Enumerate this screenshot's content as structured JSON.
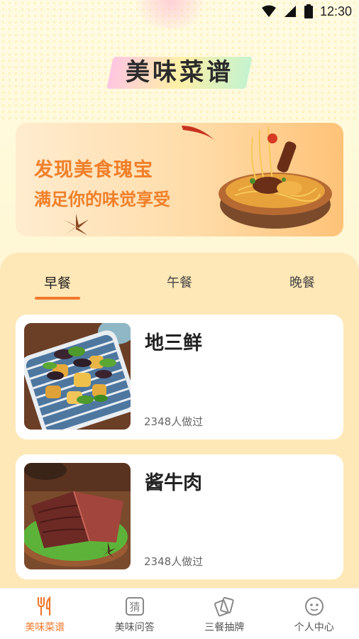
{
  "status_bar": {
    "time": "12:30"
  },
  "app": {
    "title": "美味菜谱"
  },
  "banner": {
    "line1": "发现美食瑰宝",
    "line2": "满足你的味觉享受"
  },
  "tabs": [
    {
      "label": "早餐",
      "active": true
    },
    {
      "label": "午餐",
      "active": false
    },
    {
      "label": "晚餐",
      "active": false
    }
  ],
  "recipes": [
    {
      "name": "地三鲜",
      "count": "2348人做过"
    },
    {
      "name": "酱牛肉",
      "count": "2348人做过"
    }
  ],
  "bottom_nav": [
    {
      "label": "美味菜谱",
      "icon": "fork-knife-icon",
      "active": true
    },
    {
      "label": "美味问答",
      "icon": "guess-icon",
      "active": false
    },
    {
      "label": "三餐抽牌",
      "icon": "cards-icon",
      "active": false
    },
    {
      "label": "个人中心",
      "icon": "face-icon",
      "active": false
    }
  ],
  "colors": {
    "accent": "#ef7a2e",
    "banner_text": "#f07f2a",
    "panel": "#ffe8b8"
  }
}
